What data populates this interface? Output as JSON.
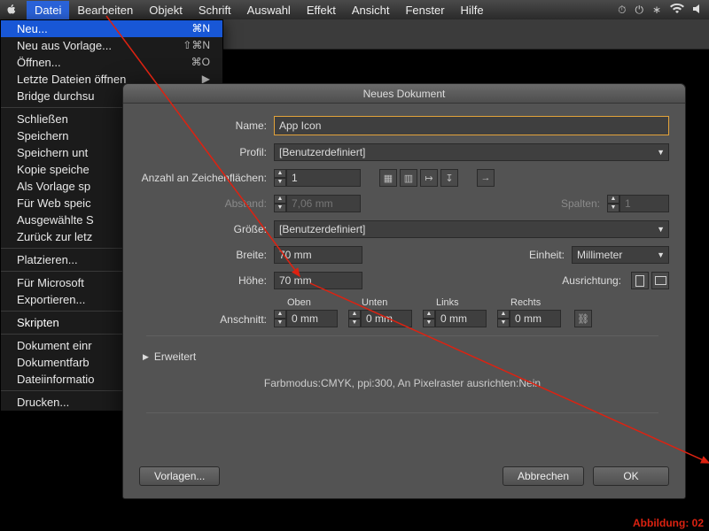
{
  "menubar": {
    "items": [
      "Datei",
      "Bearbeiten",
      "Objekt",
      "Schrift",
      "Auswahl",
      "Effekt",
      "Ansicht",
      "Fenster",
      "Hilfe"
    ]
  },
  "dropdown": {
    "items": [
      {
        "label": "Neu...",
        "shortcut": "⌘N",
        "hl": true
      },
      {
        "label": "Neu aus Vorlage...",
        "shortcut": "⇧⌘N"
      },
      {
        "label": "Öffnen...",
        "shortcut": "⌘O"
      },
      {
        "label": "Letzte Dateien öffnen",
        "shortcut": "▶"
      },
      {
        "label": "Bridge durchsu"
      },
      {
        "sep": true
      },
      {
        "label": "Schließen"
      },
      {
        "label": "Speichern"
      },
      {
        "label": "Speichern unt"
      },
      {
        "label": "Kopie speiche"
      },
      {
        "label": "Als Vorlage sp"
      },
      {
        "label": "Für Web speic"
      },
      {
        "label": "Ausgewählte S"
      },
      {
        "label": "Zurück zur letz"
      },
      {
        "sep": true
      },
      {
        "label": "Platzieren..."
      },
      {
        "sep": true
      },
      {
        "label": "Für Microsoft "
      },
      {
        "label": "Exportieren..."
      },
      {
        "sep": true
      },
      {
        "label": "Skripten",
        "bright": true
      },
      {
        "sep": true
      },
      {
        "label": "Dokument einr"
      },
      {
        "label": "Dokumentfarb"
      },
      {
        "label": "Dateiinformatio"
      },
      {
        "sep": true
      },
      {
        "label": "Drucken..."
      }
    ]
  },
  "dialog": {
    "title": "Neues Dokument",
    "name_label": "Name:",
    "name_value": "App Icon",
    "profile_label": "Profil:",
    "profile_value": "[Benutzerdefiniert]",
    "artboards_label": "Anzahl an Zeichenflächen:",
    "artboards_value": "1",
    "spacing_label": "Abstand:",
    "spacing_value": "7,06 mm",
    "columns_label": "Spalten:",
    "columns_value": "1",
    "size_label": "Größe:",
    "size_value": "[Benutzerdefiniert]",
    "width_label": "Breite:",
    "width_value": "70 mm",
    "unit_label": "Einheit:",
    "unit_value": "Millimeter",
    "height_label": "Höhe:",
    "height_value": "70 mm",
    "orient_label": "Ausrichtung:",
    "bleed_label": "Anschnitt:",
    "bleed": {
      "top_label": "Oben",
      "top_value": "0 mm",
      "bottom_label": "Unten",
      "bottom_value": "0 mm",
      "left_label": "Links",
      "left_value": "0 mm",
      "right_label": "Rechts",
      "right_value": "0 mm"
    },
    "advanced_label": "Erweitert",
    "summary": "Farbmodus:CMYK, ppi:300, An Pixelraster ausrichten:Nein",
    "templates_btn": "Vorlagen...",
    "cancel_btn": "Abbrechen",
    "ok_btn": "OK"
  },
  "caption": "Abbildung: 02"
}
